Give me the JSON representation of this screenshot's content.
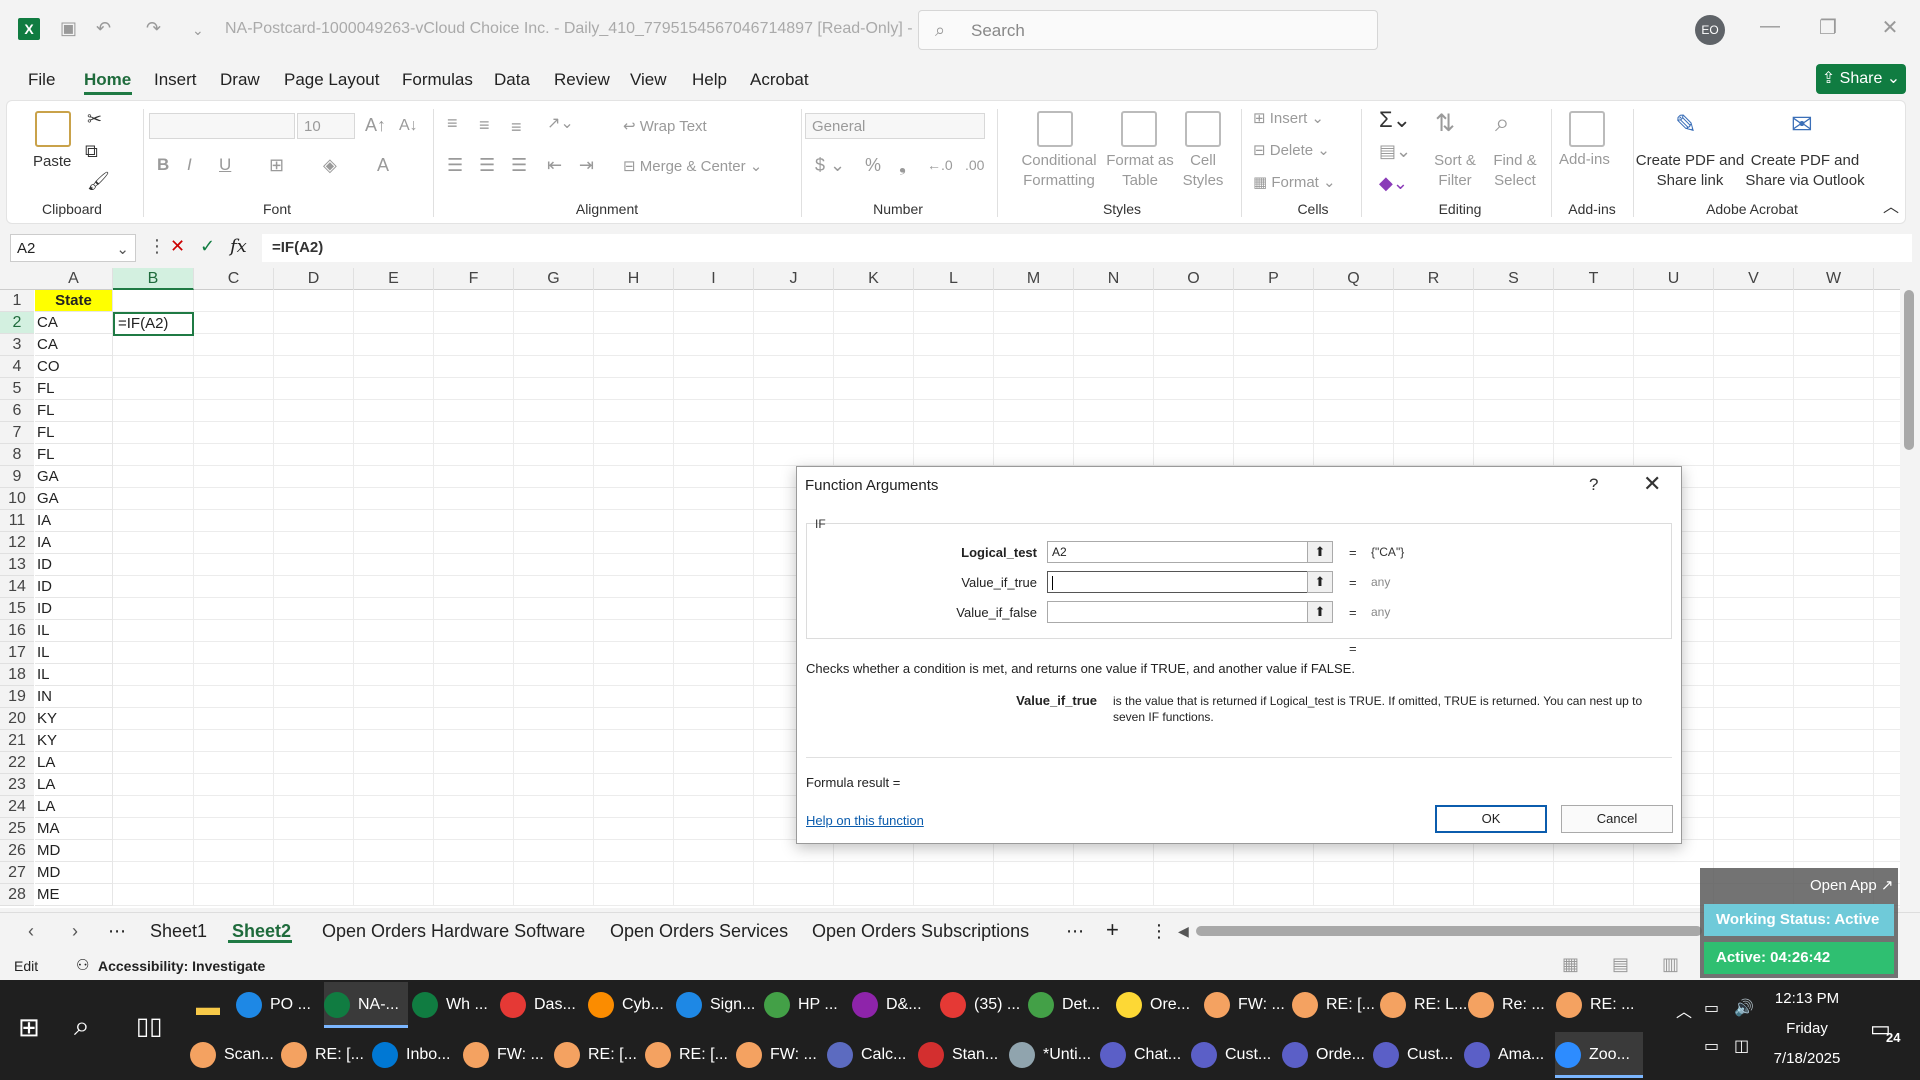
{
  "window": {
    "title": "NA-Postcard-1000049263-vCloud Choice Inc. - Daily_410_7795154567046714897  [Read-Only]  - E...",
    "search_placeholder": "Search",
    "avatar_initials": "EO"
  },
  "menu": {
    "tabs": [
      "File",
      "Home",
      "Insert",
      "Draw",
      "Page Layout",
      "Formulas",
      "Data",
      "Review",
      "View",
      "Help",
      "Acrobat"
    ],
    "share_label": "Share"
  },
  "ribbon": {
    "clipboard": {
      "paste": "Paste",
      "label": "Clipboard"
    },
    "font": {
      "size": "10",
      "label": "Font"
    },
    "alignment": {
      "wrap": "Wrap Text",
      "merge": "Merge & Center",
      "label": "Alignment"
    },
    "number": {
      "format": "General",
      "label": "Number"
    },
    "styles": {
      "conditional": "Conditional Formatting",
      "format_table": "Format as Table",
      "cell_styles": "Cell Styles",
      "label": "Styles"
    },
    "cells": {
      "insert": "Insert",
      "delete": "Delete",
      "format": "Format",
      "label": "Cells"
    },
    "editing": {
      "sort": "Sort & Filter",
      "find": "Find & Select",
      "label": "Editing"
    },
    "addins": {
      "addins": "Add-ins",
      "label": "Add-ins"
    },
    "acrobat": {
      "pdf_share": "Create PDF and Share link",
      "pdf_outlook": "Create PDF and Share via Outlook",
      "label": "Adobe Acrobat"
    }
  },
  "formula_bar": {
    "name_box": "A2",
    "formula": "=IF(A2)"
  },
  "columns": [
    "A",
    "B",
    "C",
    "D",
    "E",
    "F",
    "G",
    "H",
    "I",
    "J",
    "K",
    "L",
    "M",
    "N",
    "O",
    "P",
    "Q",
    "R",
    "S",
    "T",
    "U",
    "V",
    "W"
  ],
  "rows": [
    "1",
    "2",
    "3",
    "4",
    "5",
    "6",
    "7",
    "8",
    "9",
    "10",
    "11",
    "12",
    "13",
    "14",
    "15",
    "16",
    "17",
    "18",
    "19",
    "20",
    "21",
    "22",
    "23",
    "24",
    "25",
    "26",
    "27",
    "28"
  ],
  "column_a": [
    "State",
    "CA",
    "CA",
    "CO",
    "FL",
    "FL",
    "FL",
    "FL",
    "GA",
    "GA",
    "IA",
    "IA",
    "ID",
    "ID",
    "ID",
    "IL",
    "IL",
    "IL",
    "IN",
    "KY",
    "KY",
    "LA",
    "LA",
    "LA",
    "MA",
    "MD",
    "MD",
    "ME"
  ],
  "cell_b2": "=IF(A2)",
  "dialog": {
    "title": "Function Arguments",
    "help_glyph": "?",
    "function_name": "IF",
    "args": [
      {
        "label": "Logical_test",
        "value": "A2",
        "result": "{\"CA\"}"
      },
      {
        "label": "Value_if_true",
        "value": "",
        "result": "any"
      },
      {
        "label": "Value_if_false",
        "value": "",
        "result": "any"
      }
    ],
    "eq": "=",
    "description": "Checks whether a condition is met, and returns one value if TRUE, and another value if FALSE.",
    "arg_name": "Value_if_true",
    "arg_description": "is the value that is returned if Logical_test is TRUE. If omitted, TRUE is returned. You can nest up to seven IF functions.",
    "formula_result": "Formula result =",
    "help_link": "Help on this function",
    "ok": "OK",
    "cancel": "Cancel"
  },
  "sheets": [
    "Sheet1",
    "Sheet2",
    "Open Orders Hardware Software",
    "Open Orders Services",
    "Open Orders Subscriptions"
  ],
  "status": {
    "mode": "Edit",
    "accessibility": "Accessibility: Investigate"
  },
  "widget": {
    "open_app": "Open App ↗",
    "working_status": "Working Status: Active",
    "active_time": "Active: 04:26:42"
  },
  "taskbar": {
    "row1": [
      "PO ...",
      "NA-...",
      "Wh ...",
      "Das...",
      "Cyb...",
      "Sign...",
      "HP ...",
      "D&...",
      "(35) ...",
      "Det...",
      "Ore...",
      "FW: ...",
      "RE: [...",
      "RE: L...",
      "Re: ...",
      "RE: ..."
    ],
    "row2": [
      "Scan...",
      "RE: [...",
      "Inbo...",
      "FW: ...",
      "RE: [...",
      "RE: [...",
      "FW: ...",
      "Calc...",
      "Stan...",
      "*Unti...",
      "Chat...",
      "Cust...",
      "Orde...",
      "Cust...",
      "Ama...",
      "Zoo..."
    ],
    "time": "12:13 PM",
    "day": "Friday",
    "date": "7/18/2025",
    "notif_count": "24"
  },
  "colors": {
    "excel_green": "#107c41",
    "header_yellow": "#ffff00",
    "selected_header": "#d3f0e0"
  }
}
